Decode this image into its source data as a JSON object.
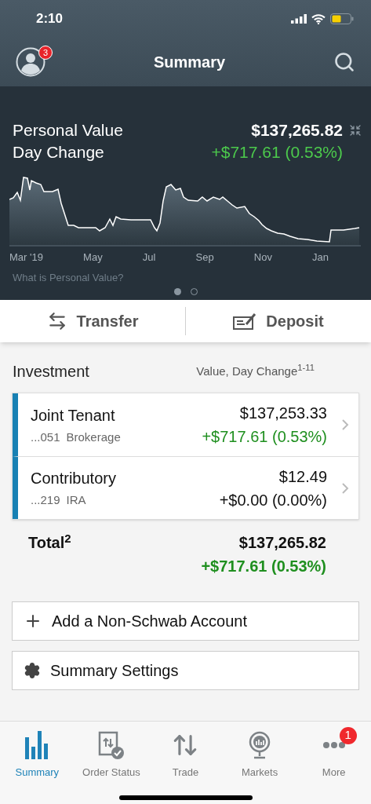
{
  "status_bar": {
    "time": "2:10"
  },
  "header": {
    "title": "Summary",
    "badge": "3"
  },
  "hero": {
    "title": "Personal Value",
    "value": "$137,265.82",
    "subtitle": "Day Change",
    "change": "+$717.61 (0.53%)",
    "x_labels": [
      "Mar '19",
      "May",
      "Jul",
      "Sep",
      "Nov",
      "Jan"
    ],
    "link": "What is Personal Value?",
    "pages": [
      {
        "selected": true
      },
      {
        "selected": false
      }
    ]
  },
  "actions": [
    {
      "kind": "transfer",
      "label": "Transfer"
    },
    {
      "kind": "deposit",
      "label": "Deposit"
    }
  ],
  "investment": {
    "title": "Investment",
    "columns_label": "Value, Day Change$^{1-11}$",
    "accounts": [
      {
        "name": "Joint Tenant",
        "number": "...051",
        "type": "Brokerage",
        "value": "$137,253.33",
        "change": "+$717.61 (0.53%)",
        "gain": true
      },
      {
        "name": "Contributory",
        "number": "...219",
        "type": "IRA",
        "value": "$12.49",
        "change": "+$0.00 (0.00%)",
        "gain": false
      }
    ],
    "total": {
      "label": "Total$^{2}$",
      "value": "$137,265.82",
      "change": "+$717.61 (0.53%)",
      "gain": true
    }
  },
  "links": [
    {
      "kind": "add",
      "label": "Add a Non-Schwab Account"
    },
    {
      "kind": "settings",
      "label": "Summary Settings"
    }
  ],
  "tab_bar": [
    {
      "kind": "summary",
      "label": "Summary",
      "selected": true
    },
    {
      "kind": "orders",
      "label": "Order Status",
      "selected": false
    },
    {
      "kind": "trade",
      "label": "Trade",
      "selected": false
    },
    {
      "kind": "markets",
      "label": "Markets",
      "selected": false
    },
    {
      "kind": "more",
      "label": "More",
      "selected": false,
      "badge": "1"
    }
  ]
}
